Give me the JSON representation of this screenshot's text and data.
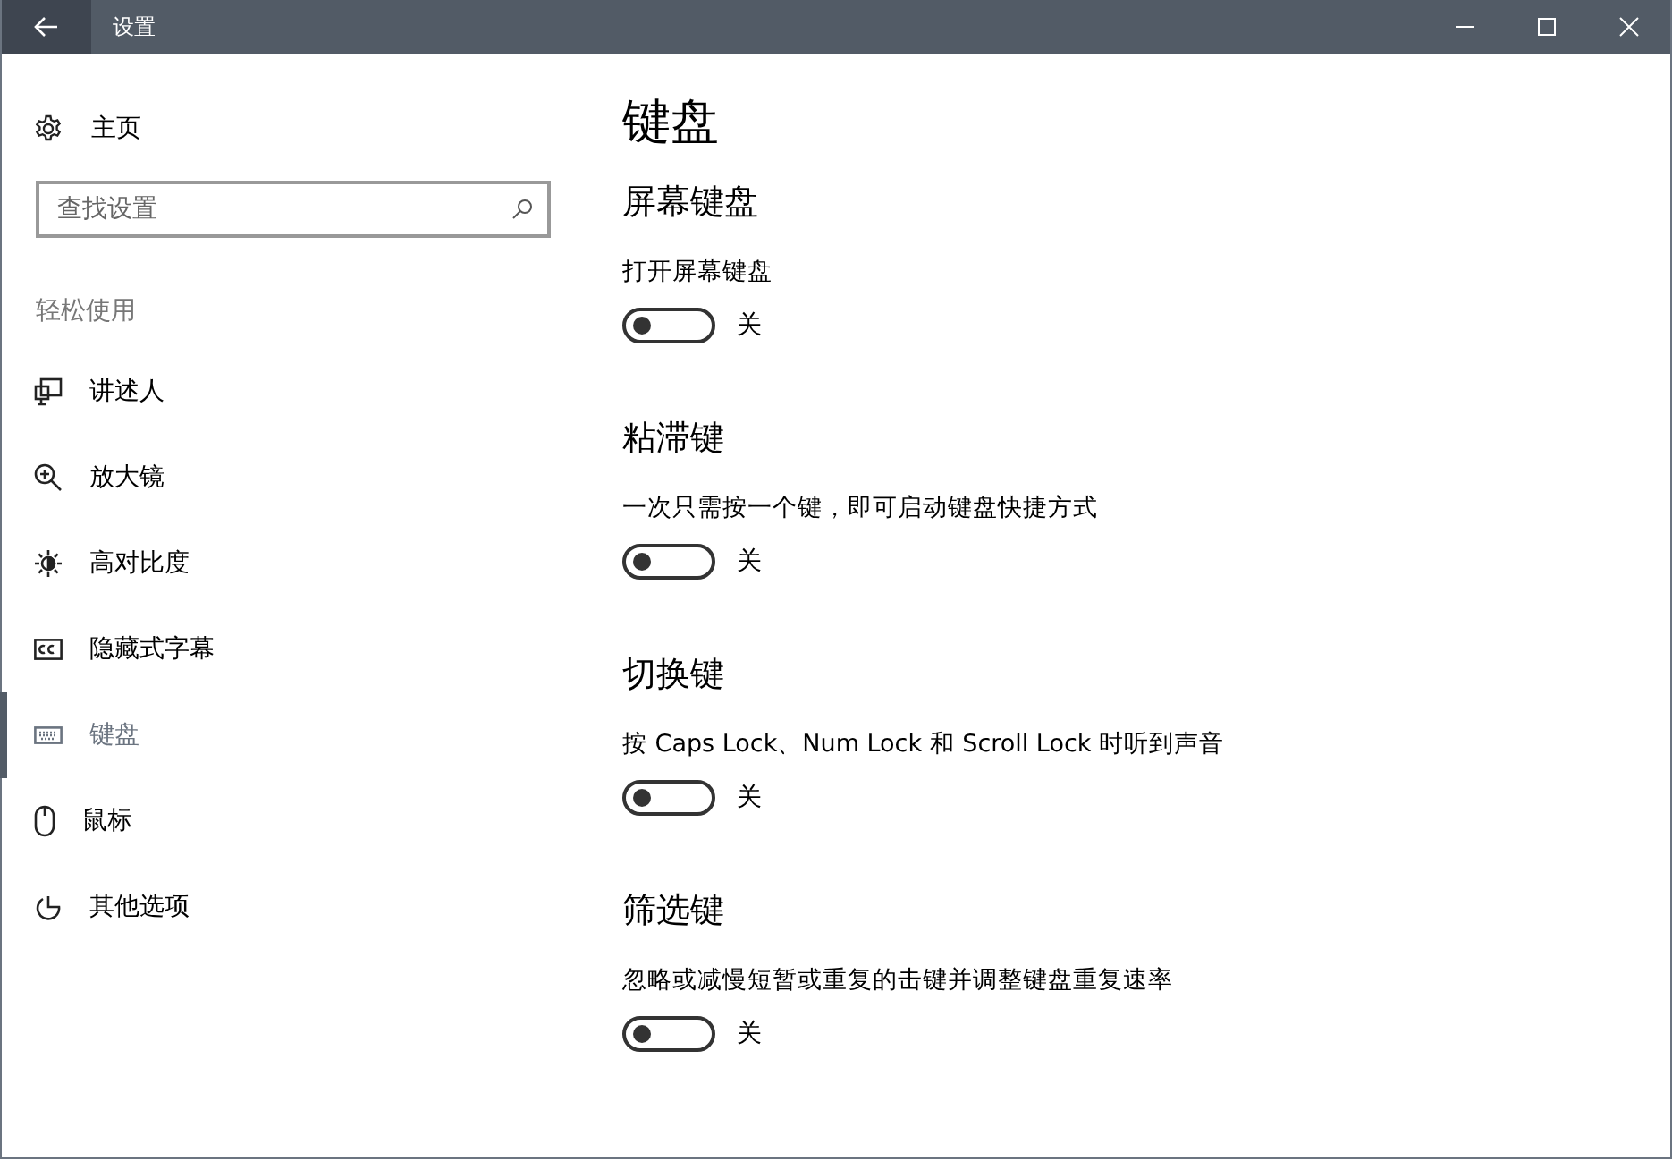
{
  "window": {
    "title": "设置"
  },
  "sidebar": {
    "home": "主页",
    "search": {
      "placeholder": "查找设置"
    },
    "group": "轻松使用",
    "items": [
      {
        "label": "讲述人",
        "selected": false
      },
      {
        "label": "放大镜",
        "selected": false
      },
      {
        "label": "高对比度",
        "selected": false
      },
      {
        "label": "隐藏式字幕",
        "selected": false
      },
      {
        "label": "键盘",
        "selected": true
      },
      {
        "label": "鼠标",
        "selected": false
      },
      {
        "label": "其他选项",
        "selected": false
      }
    ]
  },
  "page": {
    "title": "键盘",
    "sections": [
      {
        "heading": "屏幕键盘",
        "description": "打开屏幕键盘",
        "on": false,
        "state": "关"
      },
      {
        "heading": "粘滞键",
        "description": "一次只需按一个键，即可启动键盘快捷方式",
        "on": false,
        "state": "关"
      },
      {
        "heading": "切换键",
        "description": "按 Caps Lock、Num Lock 和 Scroll Lock 时听到声音",
        "on": false,
        "state": "关"
      },
      {
        "heading": "筛选键",
        "description": "忽略或减慢短暂或重复的击键并调整键盘重复速率",
        "on": false,
        "state": "关"
      }
    ]
  }
}
